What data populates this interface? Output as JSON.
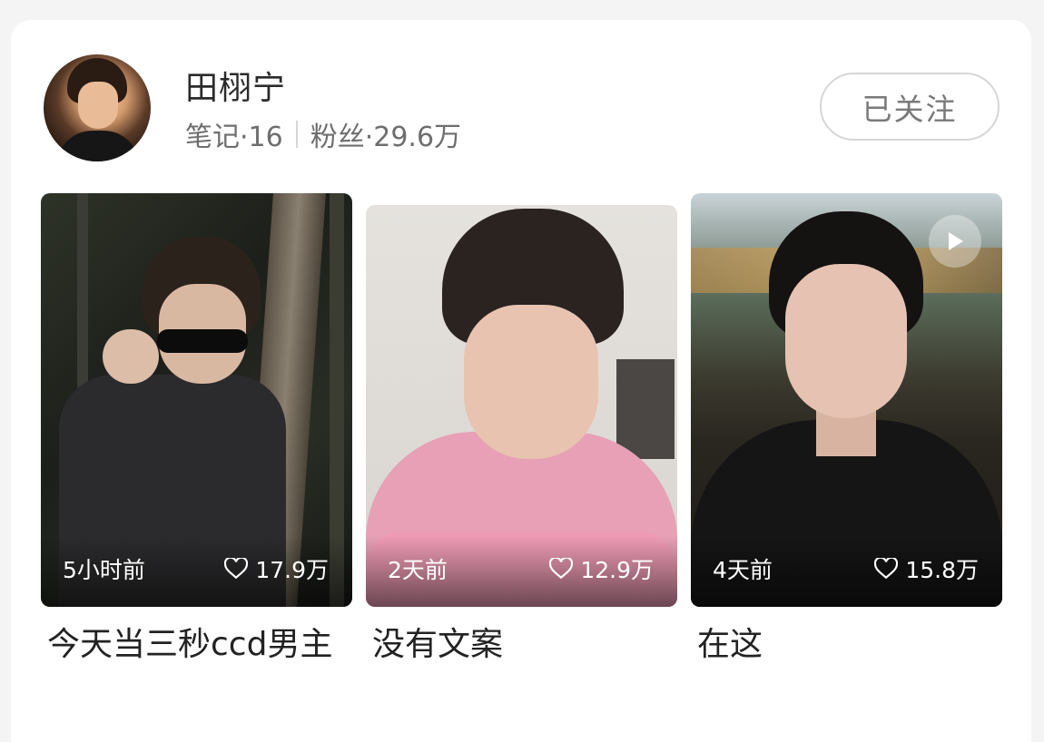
{
  "profile": {
    "name": "田栩宁",
    "notes_label": "笔记·16",
    "fans_label": "粉丝·29.6万",
    "follow_button": "已关注"
  },
  "notes": [
    {
      "time": "5小时前",
      "likes": "17.9万",
      "title": "今天当三秒ccd男主"
    },
    {
      "time": "2天前",
      "likes": "12.9万",
      "title": "没有文案"
    },
    {
      "time": "4天前",
      "likes": "15.8万",
      "title": "在这",
      "is_video": true
    }
  ],
  "icons": {
    "like": "heart-outline-icon",
    "play": "play-icon"
  }
}
